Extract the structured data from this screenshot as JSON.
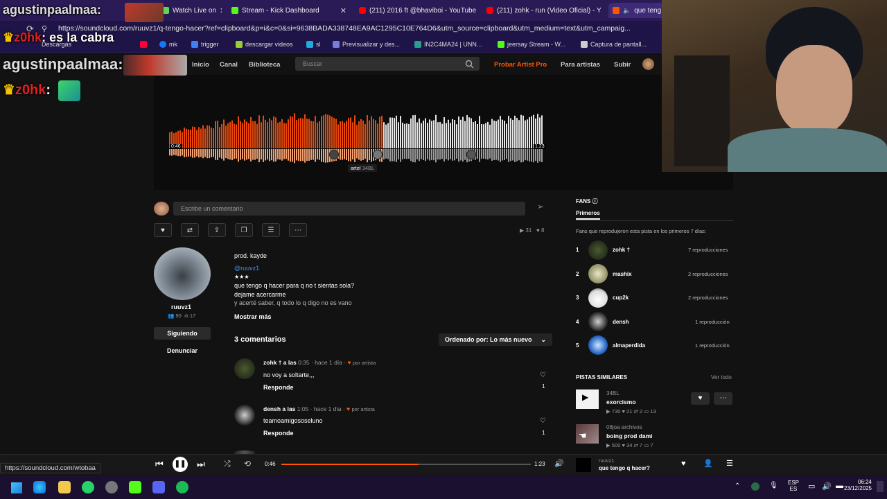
{
  "browser": {
    "tabs": [
      {
        "title": "Watch Live on",
        "favicon_color": "#5bd85b"
      },
      {
        "title": "Stream - Kick Dashboard",
        "favicon_color": "#53fc18"
      },
      {
        "title": "(211) 2016 ft @bhaviboi - YouTube",
        "favicon_color": "#ff0000"
      },
      {
        "title": "(211) zohk - run (Video Oficial) - Y",
        "favicon_color": "#ff0000"
      },
      {
        "title": "que teng",
        "favicon_color": "#ff5500"
      }
    ],
    "url": "https://soundcloud.com/ruuvz1/q-tengo-hacer?ref=clipboard&p=i&c=0&si=9638BADA338748EA9AC1295C10E764D6&utm_source=clipboard&utm_medium=text&utm_campaig...",
    "bookmarks": [
      "Descargas",
      "mk",
      "trigger",
      "descargar videos",
      "sl",
      "Previsualizar y des...",
      "IN2C4MA24 | UNN...",
      "jeersay Stream - W...",
      "Captura de pantall..."
    ]
  },
  "chat": [
    {
      "user": "agustinpaalmaa:",
      "message": ""
    },
    {
      "user": "z0hk",
      "message": ": es la cabra"
    },
    {
      "user": "agustinpaalmaa:",
      "message": ""
    },
    {
      "user": "z0hk",
      "message": ":"
    }
  ],
  "sc_nav": {
    "links": [
      "Inicio",
      "Canal",
      "Biblioteca"
    ],
    "search_placeholder": "Buscar",
    "right_links": [
      "Probar Artist Pro",
      "Para artistas",
      "Subir"
    ]
  },
  "waveform": {
    "start_time": "0:46",
    "end_time": "1:23",
    "progress": 0.57,
    "comment_tag_user": "artel",
    "comment_tag_text": "34BL"
  },
  "comment_input": {
    "placeholder": "Escribe un comentario"
  },
  "stats": {
    "plays": "31",
    "likes": "8"
  },
  "artist": {
    "name": "ruuvz1",
    "followers": "90",
    "tracks": "17",
    "following_label": "Siguiendo",
    "report_label": "Denunciar"
  },
  "description": {
    "lines": [
      "prod. kayde",
      "@ruuvz1",
      "★★★",
      "que tengo q hacer para q no t sientas sola?",
      "dejame acercarme",
      "y acerté saber, q todo lo q digo no es vano"
    ],
    "show_more": "Mostrar más"
  },
  "comments_section": {
    "count_label": "3 comentarios",
    "sort_label": "Ordenado por: Lo más nuevo",
    "items": [
      {
        "user": "zohk † a las",
        "time": "0:35",
        "ago": "· hace 1 día ·",
        "artist_tag": "por artista",
        "text": "no voy a soltarte,,,",
        "reply": "Responde",
        "likes": "1"
      },
      {
        "user": "densh a las",
        "time": "1:05",
        "ago": "· hace 1 día ·",
        "artist_tag": "por artista",
        "text": "teamoamigososeluno",
        "reply": "Responde",
        "likes": "1"
      }
    ]
  },
  "fans": {
    "title": "FANS",
    "tab": "Primeros",
    "subtitle": "Fans que reprodujeron esta pista en los primeros 7 días:",
    "list": [
      {
        "rank": "1",
        "name": "zohk †",
        "plays": "7 reproducciones"
      },
      {
        "rank": "2",
        "name": "mashix",
        "plays": "2 reproducciones"
      },
      {
        "rank": "3",
        "name": "cup2k",
        "plays": "2 reproducciones"
      },
      {
        "rank": "4",
        "name": "densh",
        "plays": "1 reproducción"
      },
      {
        "rank": "5",
        "name": "almaperdida",
        "plays": "1 reproducción"
      }
    ]
  },
  "similar": {
    "title": "PISTAS SIMILARES",
    "see_all": "Ver todo",
    "tracks": [
      {
        "artist": "34BL",
        "title": "exorcismo",
        "plays": "730",
        "likes": "21",
        "reposts": "2",
        "comments": "13"
      },
      {
        "artist": "08joa archivos",
        "title": "boing prod dami",
        "plays": "500",
        "likes": "34",
        "reposts": "7",
        "comments": "7"
      }
    ]
  },
  "player": {
    "elapsed": "0:46",
    "duration": "1:23",
    "progress": 0.55,
    "artist": "ruuvz1",
    "title": "que tengo q hacer?"
  },
  "status_url": "https://soundcloud.com/wtobaa",
  "taskbar": {
    "lang": "ESP",
    "lang2": "ES",
    "time": "06:24",
    "date": "23/12/2025"
  },
  "colors": {
    "accent": "#ff5500",
    "played": "#e8490a",
    "unplayed": "#e6e6e6"
  }
}
